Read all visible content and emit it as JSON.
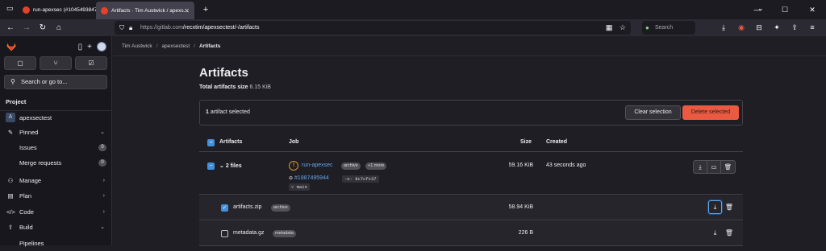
{
  "browser": {
    "tabs": [
      {
        "title": "run-apexsec (#10454938475) · ..."
      },
      {
        "title": "Artifacts · Tim Austwick / apexs..."
      }
    ],
    "new_tab": "+",
    "url_host": "https://gitlab.com",
    "url_path": "/recxtim/apexsectest/-/artifacts",
    "search_placeholder": "Search",
    "win_min": "—",
    "win_max": "☐",
    "win_close": "✕"
  },
  "sidebar": {
    "new_label": "+",
    "search_label": "Search or go to...",
    "section_title": "Project",
    "project_initial": "A",
    "project_name": "apexsectest",
    "pinned_label": "Pinned",
    "items": [
      {
        "label": "Issues",
        "count": "0"
      },
      {
        "label": "Merge requests",
        "count": "0"
      }
    ],
    "groups": [
      {
        "label": "Manage"
      },
      {
        "label": "Plan"
      },
      {
        "label": "Code"
      },
      {
        "label": "Build"
      },
      {
        "label": "Pipelines"
      }
    ]
  },
  "breadcrumb": {
    "items": [
      "Tim Austwick",
      "apexsectest",
      "Artifacts"
    ],
    "separator": "/"
  },
  "page": {
    "title": "Artifacts",
    "total_label": "Total artifacts size",
    "total_value": "6.15 KiB"
  },
  "selection": {
    "count": "1",
    "text": "artifact selected",
    "clear_label": "Clear selection",
    "delete_label": "Delete selected"
  },
  "table": {
    "headers": {
      "artifacts": "Artifacts",
      "job": "Job",
      "size": "Size",
      "created": "Created"
    },
    "group": {
      "toggle_label": "2 files",
      "job_name": "run-apexsec",
      "job_badge": "archive",
      "more_badge": "+1 more",
      "pipeline_id": "#1887495944",
      "commit_sha": "8c7cfc37",
      "branch": "main",
      "size": "59.16 KiB",
      "created": "43 seconds ago"
    },
    "files": [
      {
        "name": "artifacts.zip",
        "badge": "archive",
        "size": "58.94 KiB",
        "checked": true
      },
      {
        "name": "metadata.gz",
        "badge": "metadata",
        "size": "226 B",
        "checked": false
      }
    ]
  },
  "colors": {
    "accent_blue": "#428fdc",
    "link_blue": "#63a6e9",
    "danger": "#ec5941",
    "warning": "#d99530",
    "brand_orange": "#e24329"
  }
}
